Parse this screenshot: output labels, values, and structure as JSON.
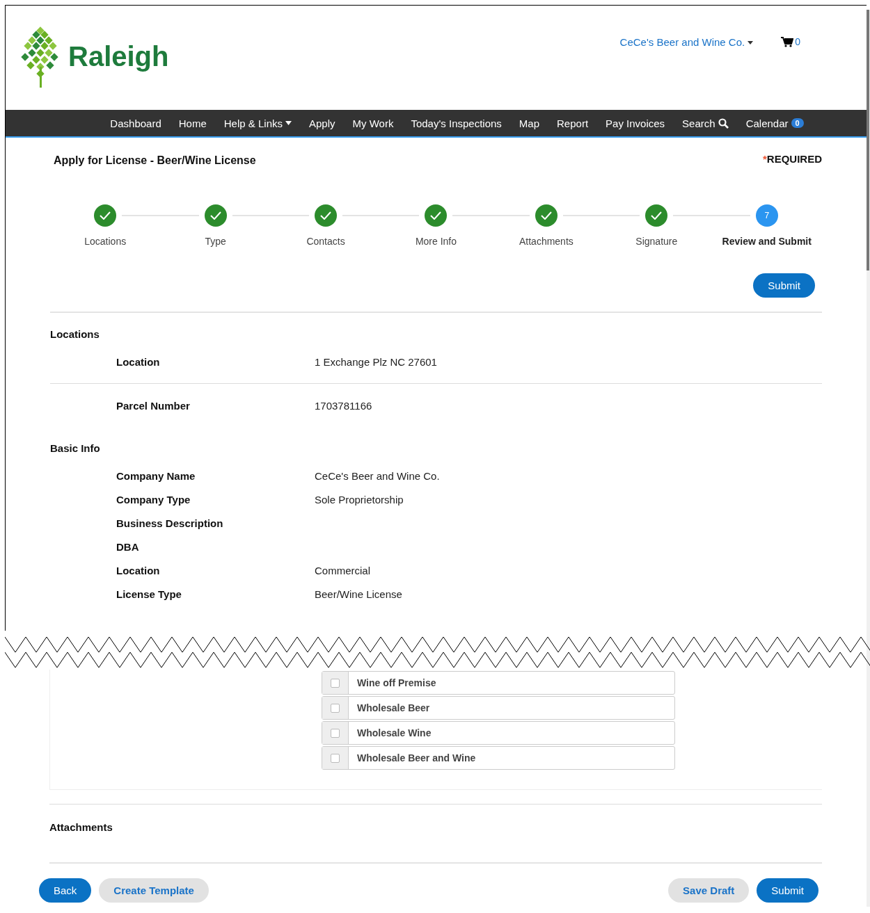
{
  "header": {
    "logo_text": "Raleigh",
    "account": "CeCe's Beer and Wine Co.",
    "cart_count": "0"
  },
  "nav": [
    {
      "label": "Dashboard"
    },
    {
      "label": "Home"
    },
    {
      "label": "Help & Links",
      "kind": "dropdown"
    },
    {
      "label": "Apply"
    },
    {
      "label": "My Work"
    },
    {
      "label": "Today's Inspections"
    },
    {
      "label": "Map"
    },
    {
      "label": "Report"
    },
    {
      "label": "Pay Invoices"
    },
    {
      "label": "Search",
      "kind": "search"
    },
    {
      "label": "Calendar",
      "badge": "0"
    }
  ],
  "page": {
    "title": "Apply for License - Beer/Wine License",
    "required_mark": "*",
    "required": "REQUIRED"
  },
  "steps": [
    {
      "label": "Locations",
      "completed": true,
      "selected": false
    },
    {
      "label": "Type",
      "completed": true,
      "selected": false
    },
    {
      "label": "Contacts",
      "completed": true,
      "selected": false
    },
    {
      "label": "More Info",
      "completed": true,
      "selected": false
    },
    {
      "label": "Attachments",
      "completed": true,
      "selected": false
    },
    {
      "label": "Signature",
      "completed": true,
      "selected": false
    },
    {
      "label": "Review and Submit",
      "completed": false,
      "selected": true,
      "number": "7"
    }
  ],
  "top_button": "Submit",
  "sections": [
    {
      "title": "Locations",
      "groups": [
        [
          {
            "label": "Location",
            "value": "1 Exchange Plz NC 27601"
          }
        ],
        [
          {
            "label": "Parcel Number",
            "value": "1703781166"
          }
        ]
      ]
    },
    {
      "title": "Basic Info",
      "groups": [
        [
          {
            "label": "Company Name",
            "value": "CeCe's Beer and Wine Co."
          },
          {
            "label": "Company Type",
            "value": "Sole Proprietorship"
          },
          {
            "label": "Business Description"
          },
          {
            "label": "DBA"
          },
          {
            "label": "Location",
            "value": "Commercial"
          },
          {
            "label": "License Type",
            "value": "Beer/Wine License"
          }
        ]
      ]
    }
  ],
  "license_options": [
    {
      "label": "Wine off Premise",
      "checked": false
    },
    {
      "label": "Wholesale Beer",
      "checked": false
    },
    {
      "label": "Wholesale Wine",
      "checked": false
    },
    {
      "label": "Wholesale Beer and Wine",
      "checked": false
    }
  ],
  "attachments_title": "Attachments",
  "footer_left": [
    {
      "label": "Back",
      "kind": "primary"
    },
    {
      "label": "Create Template",
      "kind": "secondary"
    }
  ],
  "footer_right": [
    {
      "label": "Save Draft",
      "kind": "secondary"
    },
    {
      "label": "Submit",
      "kind": "primary"
    }
  ]
}
